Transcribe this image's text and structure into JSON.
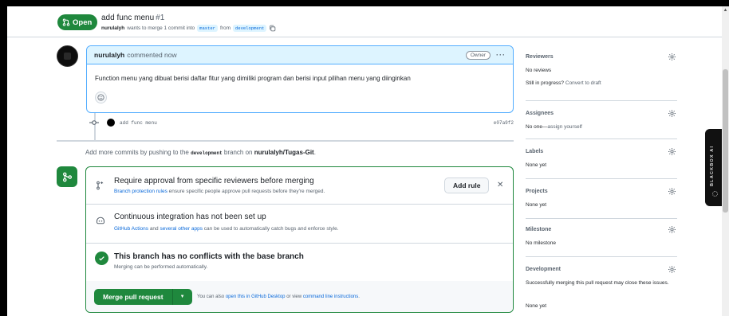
{
  "header": {
    "state": "Open",
    "title": "add func menu",
    "number": "#1",
    "author": "nurulalyh",
    "merge_text": "wants to merge 1 commit into",
    "base_branch": "master",
    "from_text": "from",
    "head_branch": "development"
  },
  "comment": {
    "author": "nurulalyh",
    "action": "commented now",
    "badge": "Owner",
    "more": "···",
    "body": "Function menu yang dibuat berisi daftar fitur yang dimiliki program dan berisi input pilihan menu yang diinginkan"
  },
  "commit": {
    "message": "add func menu",
    "sha": "e07a9f2"
  },
  "push_note": {
    "prefix": "Add more commits by pushing to the",
    "branch": "development",
    "middle": "branch on",
    "repo": "nurulalyh/Tugas-Git",
    "suffix": "."
  },
  "merge_box": {
    "approval_title": "Require approval from specific reviewers before merging",
    "approval_link": "Branch protection rules",
    "approval_desc": "ensure specific people approve pull requests before they're merged.",
    "add_rule": "Add rule",
    "close": "✕",
    "ci_title": "Continuous integration has not been set up",
    "ci_link1": "GitHub Actions",
    "ci_and": "and",
    "ci_link2": "several other apps",
    "ci_desc": "can be used to automatically catch bugs and enforce style.",
    "conflict_title": "This branch has no conflicts with the base branch",
    "conflict_desc": "Merging can be performed automatically.",
    "merge_button": "Merge pull request",
    "dropdown": "▼",
    "footer_prefix": "You can also",
    "footer_link1": "open this in GitHub Desktop",
    "footer_or": "or view",
    "footer_link2": "command line instructions",
    "footer_suffix": "."
  },
  "sidebar": {
    "reviewers": {
      "label": "Reviewers",
      "value": "No reviews",
      "extra_prefix": "Still in progress?",
      "extra_link": "Convert to draft"
    },
    "assignees": {
      "label": "Assignees",
      "value_prefix": "No one—",
      "value_link": "assign yourself"
    },
    "labels": {
      "label": "Labels",
      "value": "None yet"
    },
    "projects": {
      "label": "Projects",
      "value": "None yet"
    },
    "milestone": {
      "label": "Milestone",
      "value": "No milestone"
    },
    "development": {
      "label": "Development",
      "value": "Successfully merging this pull request may close these issues.",
      "value2": "None yet"
    }
  },
  "extension": {
    "label": "BLACKBOX AI"
  },
  "colors": {
    "green": "#1f883d",
    "blue_link": "#0969da",
    "comment_header": "#ddf4ff"
  }
}
